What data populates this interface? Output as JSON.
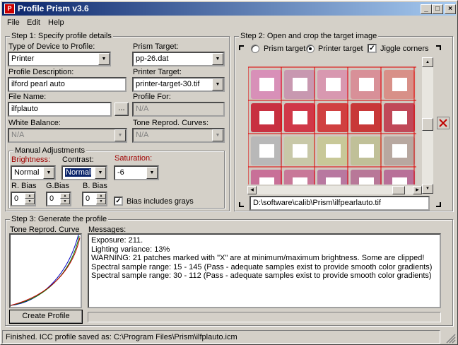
{
  "window": {
    "title": "Profile Prism v3.6",
    "icon": "prism-icon"
  },
  "menu": [
    "File",
    "Edit",
    "Help"
  ],
  "step1": {
    "title": "Step 1: Specify profile details",
    "device_type": {
      "label": "Type of Device to Profile:",
      "value": "Printer"
    },
    "prism_target": {
      "label": "Prism Target:",
      "value": "pp-26.dat"
    },
    "description": {
      "label": "Profile Description:",
      "value": "ilford pearl auto"
    },
    "printer_target": {
      "label": "Printer Target:",
      "value": "printer-target-30.tif"
    },
    "file_name": {
      "label": "File Name:",
      "value": "ilfplauto",
      "browse": "..."
    },
    "profile_for": {
      "label": "Profile For:",
      "value": "N/A"
    },
    "white_balance": {
      "label": "White Balance:",
      "value": "N/A"
    },
    "tone_curves": {
      "label": "Tone Reprod. Curves:",
      "value": "N/A"
    },
    "manual": {
      "title": "Manual Adjustments",
      "brightness": {
        "label": "Brightness:",
        "value": "Normal"
      },
      "contrast": {
        "label": "Contrast:",
        "value": "Normal"
      },
      "saturation": {
        "label": "Saturation:",
        "value": "-6"
      },
      "r_bias": {
        "label": "R. Bias",
        "value": "0"
      },
      "g_bias": {
        "label": "G.Bias",
        "value": "0"
      },
      "b_bias": {
        "label": "B. Bias",
        "value": "0"
      },
      "bias_grays": {
        "label": "Bias includes grays",
        "checked": true
      }
    }
  },
  "step2": {
    "title": "Step 2: Open and crop the target image",
    "radio_prism": "Prism target",
    "radio_printer": "Printer target",
    "jiggle": "Jiggle corners",
    "path": "D:\\software\\calib\\Prism\\ilfpearlauto.tif",
    "delete_icon": "red-x-icon"
  },
  "step3": {
    "title": "Step 3: Generate the profile",
    "curve_label": "Tone Reprod. Curve",
    "messages_label": "Messages:",
    "messages": [
      "Exposure: 211.",
      "Lighting variance:  13%",
      "WARNING: 21 patches marked with \"X\" are at minimum/maximum brightness.  Some are clipped!",
      "Spectral sample range: 15 - 145 (Pass - adequate samples exist to provide smooth color gradients)",
      "Spectral sample range: 30 - 112 (Pass - adequate samples exist to provide smooth color gradients)"
    ],
    "create_button": "Create Profile"
  },
  "status": "Finished.  ICC profile saved as: C:\\Program Files\\Prism\\ilfplauto.icm",
  "patches": [
    [
      "#d890b8",
      "#c898b0",
      "#d898b0",
      "#d89098",
      "#d89088"
    ],
    [
      "#c83040",
      "#d03848",
      "#d04040",
      "#c83838",
      "#c04858"
    ],
    [
      "#b8b8b8",
      "#c8c8a8",
      "#c8c898",
      "#c0c098",
      "#b8a8a0"
    ],
    [
      "#c87098",
      "#c87898",
      "#b878a0",
      "#b87898",
      "#b87098"
    ]
  ]
}
